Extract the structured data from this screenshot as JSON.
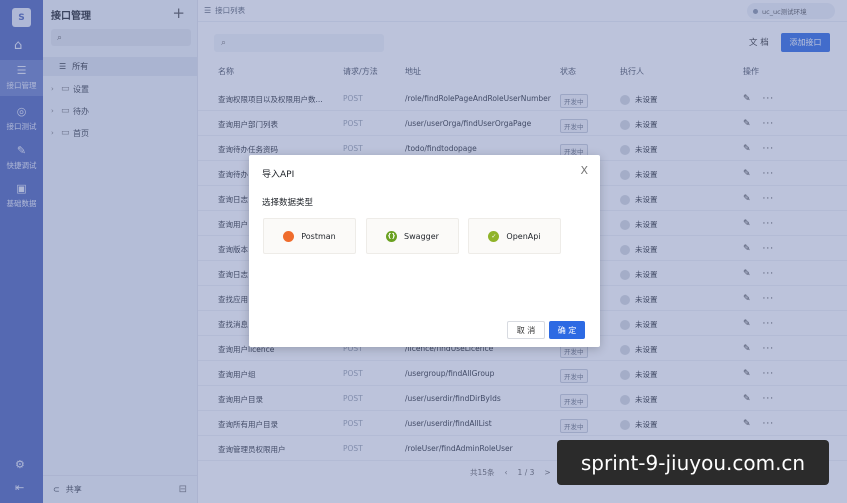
{
  "rail": {
    "logo": "S",
    "items": [
      {
        "label": "接口管理",
        "icon": "api-icon"
      },
      {
        "label": "接口测试",
        "icon": "test-icon"
      },
      {
        "label": "快捷调试",
        "icon": "debug-icon"
      },
      {
        "label": "基础数据",
        "icon": "database-icon"
      }
    ]
  },
  "sidebar": {
    "title": "接口管理",
    "search_placeholder": "",
    "all_label": "所有",
    "nodes": [
      {
        "label": "设置"
      },
      {
        "label": "待办"
      },
      {
        "label": "首页"
      }
    ],
    "footer_label": "共享"
  },
  "topbar": {
    "breadcrumb": "接口列表",
    "env_label": "uc_uc测试环境"
  },
  "toolbar": {
    "search_placeholder": "",
    "doc_label": "文 档",
    "add_label": "添加接口"
  },
  "table": {
    "headers": [
      "名称",
      "请求/方法",
      "地址",
      "状态",
      "执行人",
      "操作"
    ],
    "rows": [
      {
        "name": "查询权限项目以及权限用户数...",
        "method": "POST",
        "path": "/role/findRolePageAndRoleUserNumber",
        "status": "开发中",
        "executor": "未设置"
      },
      {
        "name": "查询用户部门列表",
        "method": "POST",
        "path": "/user/userOrga/findUserOrgaPage",
        "status": "开发中",
        "executor": "未设置"
      },
      {
        "name": "查询待办任务资码",
        "method": "POST",
        "path": "/todo/findtodopage",
        "status": "开发中",
        "executor": "未设置"
      },
      {
        "name": "查询待办",
        "method": "",
        "path": "",
        "status": "",
        "executor": "未设置"
      },
      {
        "name": "查询日志",
        "method": "",
        "path": "",
        "status": "",
        "executor": "未设置"
      },
      {
        "name": "查询用户",
        "method": "",
        "path": "",
        "status": "",
        "executor": "未设置"
      },
      {
        "name": "查询版本",
        "method": "",
        "path": "",
        "status": "",
        "executor": "未设置"
      },
      {
        "name": "查询日志",
        "method": "",
        "path": "",
        "status": "",
        "executor": "未设置"
      },
      {
        "name": "查找应用",
        "method": "",
        "path": "",
        "status": "",
        "executor": "未设置"
      },
      {
        "name": "查找消息",
        "method": "",
        "path": "",
        "status": "",
        "executor": "未设置"
      },
      {
        "name": "查询用户licence",
        "method": "POST",
        "path": "/licence/findUseLicence",
        "status": "开发中",
        "executor": "未设置"
      },
      {
        "name": "查询用户组",
        "method": "POST",
        "path": "/usergroup/findAllGroup",
        "status": "开发中",
        "executor": "未设置"
      },
      {
        "name": "查询用户目录",
        "method": "POST",
        "path": "/user/userdir/findDirByIds",
        "status": "开发中",
        "executor": "未设置"
      },
      {
        "name": "查询所有用户目录",
        "method": "POST",
        "path": "/user/userdir/findAllList",
        "status": "开发中",
        "executor": "未设置"
      },
      {
        "name": "查询管理员权限用户",
        "method": "POST",
        "path": "/roleUser/findAdminRoleUser",
        "status": "开发中",
        "executor": "未设置"
      }
    ]
  },
  "pager": {
    "total": "共15条",
    "page": "1 / 3",
    "next": ">"
  },
  "modal": {
    "title": "导入API",
    "close": "X",
    "label": "选择数据类型",
    "types": [
      {
        "label": "Postman",
        "icon_glyph": "",
        "color": "#ef6c2d"
      },
      {
        "label": "Swagger",
        "icon_glyph": "{}",
        "color": "#6aa121"
      },
      {
        "label": "OpenApi",
        "icon_glyph": "✓",
        "color": "#8fb329"
      }
    ],
    "cancel_label": "取 消",
    "ok_label": "确 定"
  },
  "watermark": {
    "text": "sprint-9-jiuyou.com.cn"
  }
}
